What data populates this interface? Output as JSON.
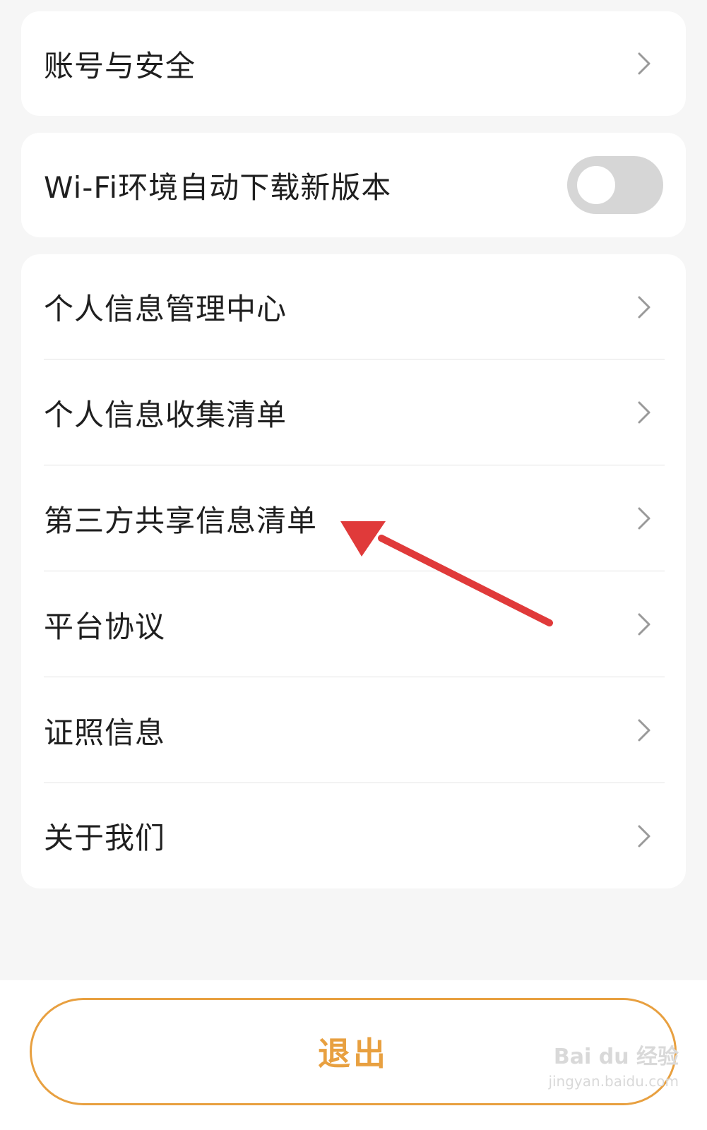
{
  "settings": {
    "account_security": {
      "label": "账号与安全",
      "icon": "chevron-right-icon"
    },
    "wifi_auto_download": {
      "label": "Wi-Fi环境自动下载新版本",
      "toggle_on": false
    },
    "menu_items": [
      {
        "label": "个人信息管理中心"
      },
      {
        "label": "个人信息收集清单"
      },
      {
        "label": "第三方共享信息清单"
      },
      {
        "label": "平台协议"
      },
      {
        "label": "证照信息"
      },
      {
        "label": "关于我们"
      }
    ]
  },
  "logout": {
    "label": "退出"
  },
  "annotation": {
    "arrow_color": "#e03a3a"
  },
  "colors": {
    "accent": "#e8a040",
    "background": "#f6f6f6",
    "card": "#ffffff",
    "toggle_off": "#d6d6d6"
  },
  "watermark": {
    "line1": "Bai du 经验",
    "line2": "jingyan.baidu.com"
  }
}
